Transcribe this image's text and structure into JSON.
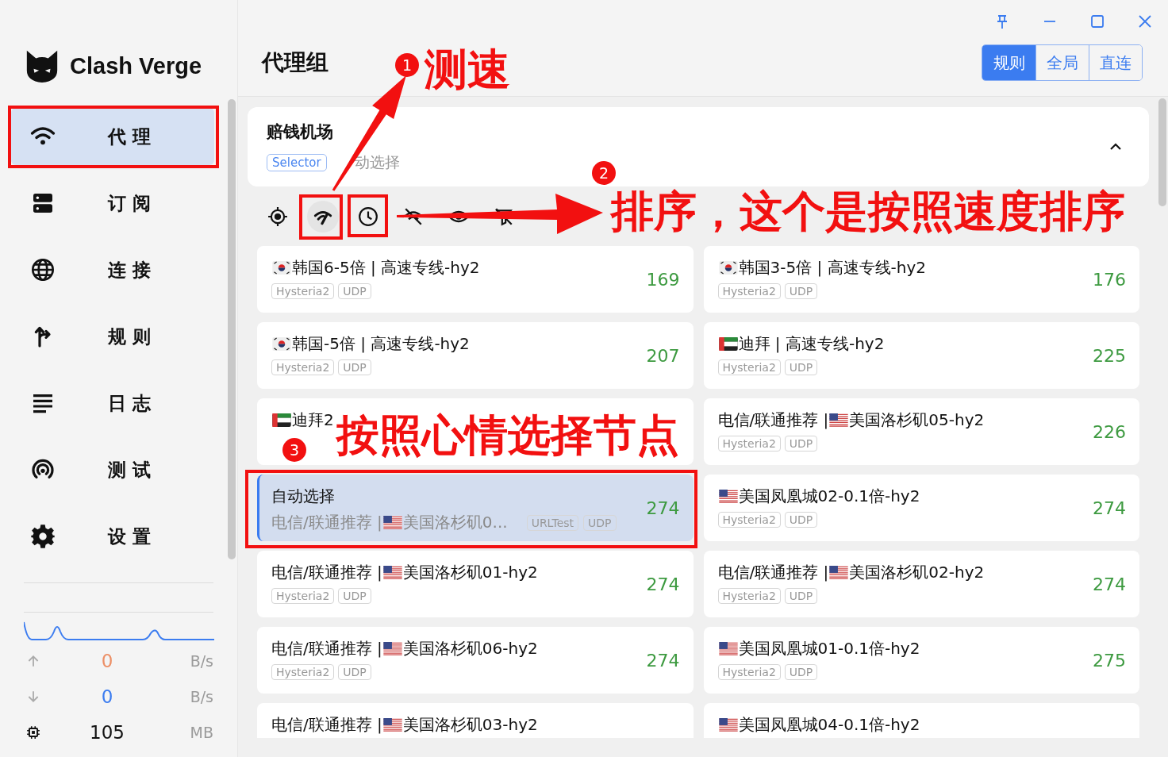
{
  "sidebar": {
    "app_name": "Clash Verge",
    "items": [
      {
        "label": "代理",
        "selected": true
      },
      {
        "label": "订阅",
        "selected": false
      },
      {
        "label": "连接",
        "selected": false
      },
      {
        "label": "规则",
        "selected": false
      },
      {
        "label": "日志",
        "selected": false
      },
      {
        "label": "测试",
        "selected": false
      },
      {
        "label": "设置",
        "selected": false
      }
    ],
    "traffic": {
      "upload": "0",
      "upload_unit": "B/s",
      "download": "0",
      "download_unit": "B/s",
      "memory": "105",
      "memory_unit": "MB"
    }
  },
  "page": {
    "title": "代理组",
    "modes": [
      {
        "label": "规则",
        "selected": true
      },
      {
        "label": "全局",
        "selected": false
      },
      {
        "label": "直连",
        "selected": false
      }
    ]
  },
  "group": {
    "name": "赔钱机场",
    "type": "Selector",
    "current": "动选择",
    "expanded": true
  },
  "proxies": [
    {
      "kind": "node",
      "flag": {
        "kind": "kr"
      },
      "name": "韩国6-5倍 | 高速专线-hy2",
      "tags": [
        "Hysteria2",
        "UDP"
      ],
      "delay": "169",
      "selected": false
    },
    {
      "kind": "node",
      "flag": {
        "kind": "kr"
      },
      "name": "韩国3-5倍 | 高速专线-hy2",
      "tags": [
        "Hysteria2",
        "UDP"
      ],
      "delay": "176",
      "selected": false
    },
    {
      "kind": "node",
      "flag": {
        "kind": "kr"
      },
      "name": "韩国-5倍 | 高速专线-hy2",
      "tags": [
        "Hysteria2",
        "UDP"
      ],
      "delay": "207",
      "selected": false
    },
    {
      "kind": "node",
      "flag": {
        "kind": "ae"
      },
      "name": "迪拜 | 高速专线-hy2",
      "tags": [
        "Hysteria2",
        "UDP"
      ],
      "delay": "225",
      "selected": false
    },
    {
      "kind": "node",
      "flag": {
        "kind": "ae"
      },
      "name": "迪拜2",
      "selected": false
    },
    {
      "kind": "node",
      "prefix": "电信/联通推荐 | ",
      "flag": {
        "kind": "us"
      },
      "name": "美国洛杉矶05-hy2",
      "tags": [
        "Hysteria2",
        "UDP"
      ],
      "delay": "226",
      "selected": false
    },
    {
      "kind": "group",
      "name": "自动选择",
      "sub_prefix": "电信/联通推荐 | ",
      "flag": {
        "kind": "us"
      },
      "sub": "美国洛杉矶0...",
      "tags": [
        "URLTest",
        "UDP"
      ],
      "delay": "274",
      "selected": true
    },
    {
      "kind": "node",
      "flag": {
        "kind": "us"
      },
      "name": "美国凤凰城02-0.1倍-hy2",
      "tags": [
        "Hysteria2",
        "UDP"
      ],
      "delay": "274",
      "selected": false
    },
    {
      "kind": "node",
      "prefix": "电信/联通推荐 | ",
      "flag": {
        "kind": "us"
      },
      "name": "美国洛杉矶01-hy2",
      "tags": [
        "Hysteria2",
        "UDP"
      ],
      "delay": "274",
      "selected": false
    },
    {
      "kind": "node",
      "prefix": "电信/联通推荐 | ",
      "flag": {
        "kind": "us"
      },
      "name": "美国洛杉矶02-hy2",
      "tags": [
        "Hysteria2",
        "UDP"
      ],
      "delay": "274",
      "selected": false
    },
    {
      "kind": "node",
      "prefix": "电信/联通推荐 | ",
      "flag": {
        "kind": "us"
      },
      "name": "美国洛杉矶06-hy2",
      "tags": [
        "Hysteria2",
        "UDP"
      ],
      "delay": "274",
      "selected": false
    },
    {
      "kind": "node",
      "flag": {
        "kind": "us"
      },
      "name": "美国凤凰城01-0.1倍-hy2",
      "tags": [
        "Hysteria2",
        "UDP"
      ],
      "delay": "275",
      "selected": false
    },
    {
      "kind": "node",
      "prefix": "电信/联通推荐 | ",
      "flag": {
        "kind": "us"
      },
      "name": "美国洛杉矶03-hy2",
      "selected": false
    },
    {
      "kind": "node",
      "flag": {
        "kind": "us"
      },
      "name": "美国凤凰城04-0.1倍-hy2",
      "selected": false
    }
  ],
  "annotations": [
    {
      "badge": "1",
      "caption": "测速"
    },
    {
      "badge": "2",
      "caption": "排序，这个是按照速度排序"
    },
    {
      "badge": "3",
      "caption": "按照心情选择节点"
    }
  ]
}
